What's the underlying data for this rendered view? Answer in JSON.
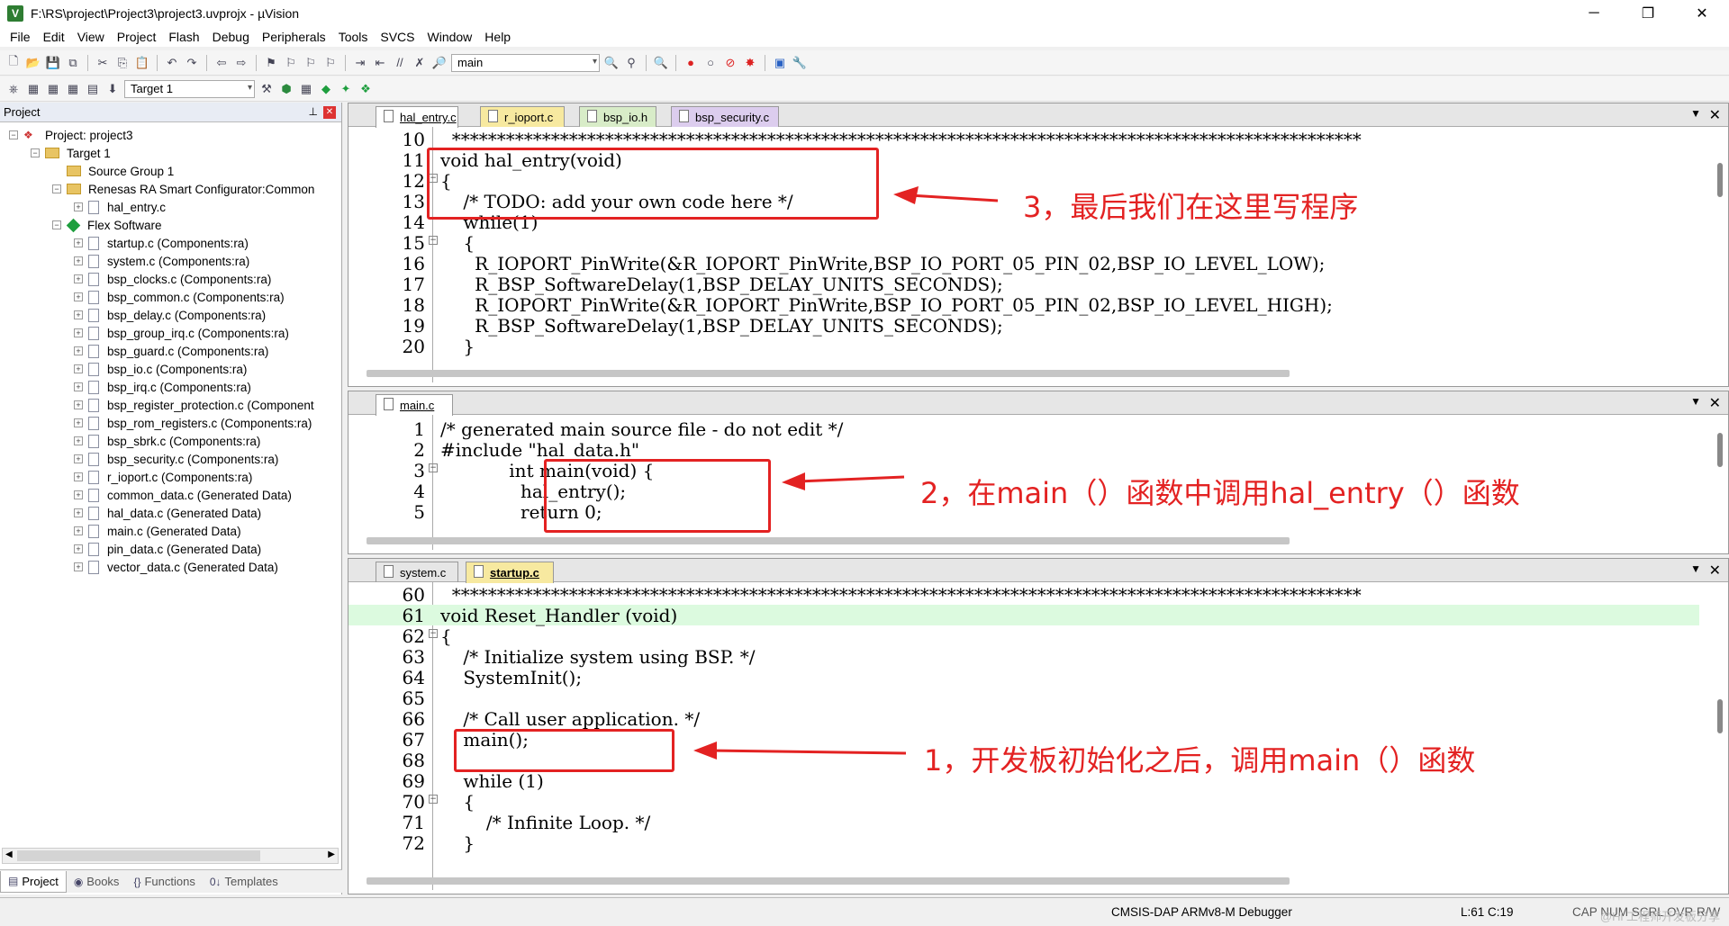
{
  "window": {
    "title": "F:\\RS\\project\\Project3\\project3.uvprojx - µVision",
    "app_icon": "V",
    "minimize": "─",
    "maximize": "❐",
    "close": "✕"
  },
  "menu": [
    "File",
    "Edit",
    "View",
    "Project",
    "Flash",
    "Debug",
    "Peripherals",
    "Tools",
    "SVCS",
    "Window",
    "Help"
  ],
  "toolbar": {
    "function_select": "main",
    "target_select": "Target 1"
  },
  "project_panel": {
    "title": "Project",
    "pin": "⊥",
    "close": "✕",
    "tree": [
      {
        "label": "Project: project3"
      },
      {
        "label": "Target 1"
      },
      {
        "label": "Source Group 1"
      },
      {
        "label": "Renesas RA Smart Configurator:Common"
      },
      {
        "label": "hal_entry.c"
      },
      {
        "label": "Flex Software"
      },
      {
        "label": "startup.c (Components:ra)"
      },
      {
        "label": "system.c (Components:ra)"
      },
      {
        "label": "bsp_clocks.c (Components:ra)"
      },
      {
        "label": "bsp_common.c (Components:ra)"
      },
      {
        "label": "bsp_delay.c (Components:ra)"
      },
      {
        "label": "bsp_group_irq.c (Components:ra)"
      },
      {
        "label": "bsp_guard.c (Components:ra)"
      },
      {
        "label": "bsp_io.c (Components:ra)"
      },
      {
        "label": "bsp_irq.c (Components:ra)"
      },
      {
        "label": "bsp_register_protection.c (Component"
      },
      {
        "label": "bsp_rom_registers.c (Components:ra)"
      },
      {
        "label": "bsp_sbrk.c (Components:ra)"
      },
      {
        "label": "bsp_security.c (Components:ra)"
      },
      {
        "label": "r_ioport.c (Components:ra)"
      },
      {
        "label": "common_data.c (Generated Data)"
      },
      {
        "label": "hal_data.c (Generated Data)"
      },
      {
        "label": "main.c (Generated Data)"
      },
      {
        "label": "pin_data.c (Generated Data)"
      },
      {
        "label": "vector_data.c (Generated Data)"
      }
    ],
    "tabs": [
      "Project",
      "Books",
      "Functions",
      "Templates"
    ]
  },
  "pane1": {
    "tabs": [
      "hal_entry.c",
      "r_ioport.c",
      "bsp_io.h",
      "bsp_security.c"
    ],
    "tab_colors": [
      "#ffffff",
      "#f7e9a0",
      "#d8ecc8",
      "#dccdee"
    ],
    "lines": [
      {
        "n": "10",
        "t": "  *****************************************************************************************************"
      },
      {
        "n": "11",
        "t": "void hal_entry(void)"
      },
      {
        "n": "12",
        "t": "{"
      },
      {
        "n": "13",
        "t": "    /* TODO: add your own code here */"
      },
      {
        "n": "14",
        "t": "    while(1)"
      },
      {
        "n": "15",
        "t": "    {"
      },
      {
        "n": "16",
        "t": "      R_IOPORT_PinWrite(&R_IOPORT_PinWrite,BSP_IO_PORT_05_PIN_02,BSP_IO_LEVEL_LOW);"
      },
      {
        "n": "17",
        "t": "      R_BSP_SoftwareDelay(1,BSP_DELAY_UNITS_SECONDS);"
      },
      {
        "n": "18",
        "t": "      R_IOPORT_PinWrite(&R_IOPORT_PinWrite,BSP_IO_PORT_05_PIN_02,BSP_IO_LEVEL_HIGH);"
      },
      {
        "n": "19",
        "t": "      R_BSP_SoftwareDelay(1,BSP_DELAY_UNITS_SECONDS);"
      },
      {
        "n": "20",
        "t": "    }"
      }
    ],
    "annotation": "3，最后我们在这里写程序"
  },
  "pane2": {
    "tabs": [
      "main.c"
    ],
    "lines": [
      {
        "n": "1",
        "t": "/* generated main source file - do not edit */"
      },
      {
        "n": "2",
        "t": "#include \"hal_data.h\""
      },
      {
        "n": "3",
        "t": "            int main(void) {"
      },
      {
        "n": "4",
        "t": "              hal_entry();"
      },
      {
        "n": "5",
        "t": "              return 0;"
      }
    ],
    "annotation": "2，在main（）函数中调用hal_entry（）函数"
  },
  "pane3": {
    "tabs": [
      "system.c",
      "startup.c"
    ],
    "tab_colors": [
      "#ffffff",
      "#f7e9a0"
    ],
    "lines": [
      {
        "n": "60",
        "t": "  *****************************************************************************************************"
      },
      {
        "n": "61",
        "t": "void Reset_Handler (void)"
      },
      {
        "n": "62",
        "t": "{"
      },
      {
        "n": "63",
        "t": "    /* Initialize system using BSP. */"
      },
      {
        "n": "64",
        "t": "    SystemInit();"
      },
      {
        "n": "65",
        "t": ""
      },
      {
        "n": "66",
        "t": "    /* Call user application. */"
      },
      {
        "n": "67",
        "t": "    main();"
      },
      {
        "n": "68",
        "t": ""
      },
      {
        "n": "69",
        "t": "    while (1)"
      },
      {
        "n": "70",
        "t": "    {"
      },
      {
        "n": "71",
        "t": "        /* Infinite Loop. */"
      },
      {
        "n": "72",
        "t": "    }"
      }
    ],
    "annotation": "1，开发板初始化之后，调用main（）函数"
  },
  "status": {
    "debugger": "CMSIS-DAP ARMv8-M Debugger",
    "position": "L:61 C:19",
    "caps": "CAP NUM SCRL OVR R/W",
    "watermark": "@Hi 工程师开发板分享"
  },
  "colors": {
    "annotation_red": "#e32222",
    "comment_green": "#208020",
    "keyword_blue": "#1b1bd6"
  }
}
